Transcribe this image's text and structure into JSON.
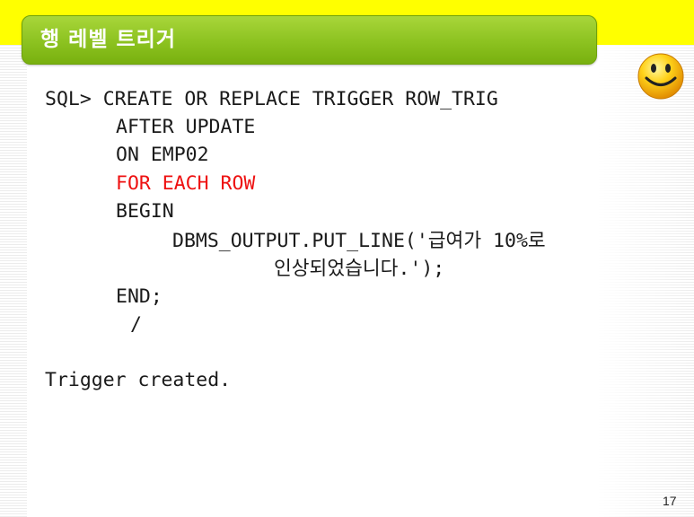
{
  "slide": {
    "title": "행 레벨 트리거",
    "page_number": "17"
  },
  "code": {
    "line1": "SQL> CREATE OR REPLACE TRIGGER ROW_TRIG",
    "line2": "AFTER UPDATE",
    "line3": "ON EMP02",
    "line4": "FOR EACH ROW",
    "line5": "BEGIN",
    "line6": "DBMS_OUTPUT.PUT_LINE('급여가 10%로",
    "line7": "인상되었습니다.');",
    "line8": "END;",
    "line9": "/",
    "line10": "Trigger created."
  },
  "colors": {
    "title_bar": "#8cc220",
    "highlight": "#ee1111",
    "top_band": "#ffff00"
  },
  "icons": {
    "mascot": "smiley-face-icon"
  }
}
